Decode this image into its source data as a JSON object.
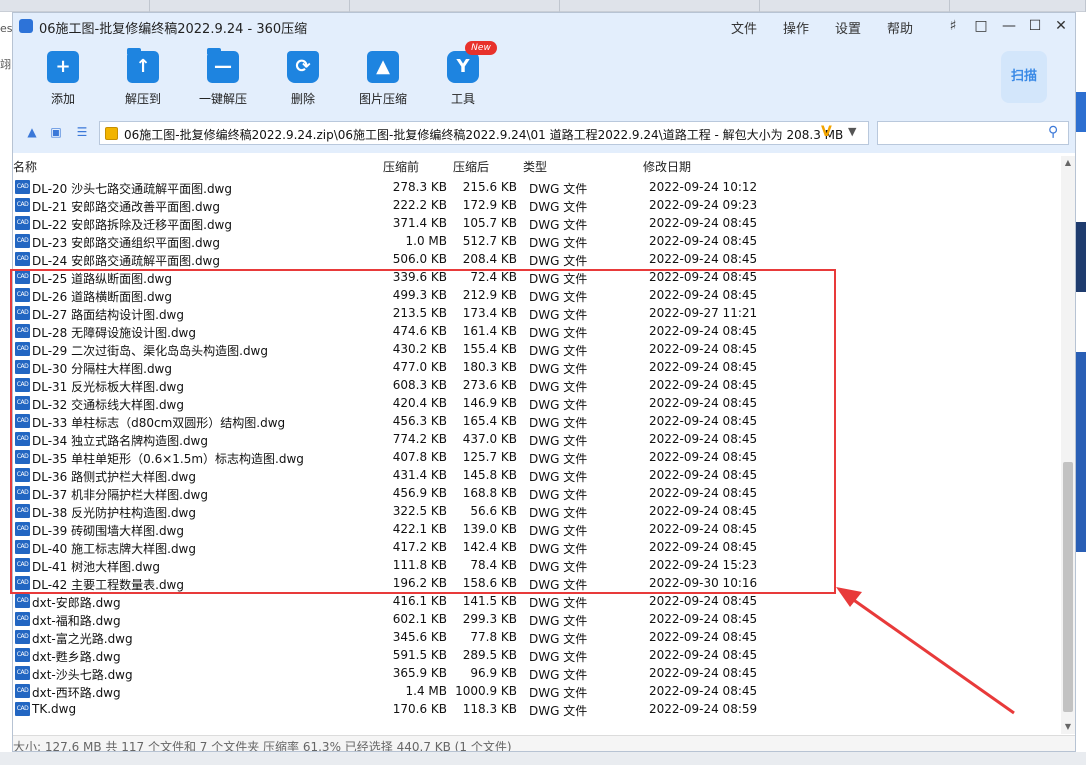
{
  "window": {
    "title": "06施工图-批复修编终稿2022.9.24 - 360压缩",
    "menus": [
      "文件",
      "操作",
      "设置",
      "帮助"
    ]
  },
  "toolbar": {
    "buttons": [
      {
        "label": "添加",
        "icon": "add-icon"
      },
      {
        "label": "解压到",
        "icon": "extract-to-icon"
      },
      {
        "label": "一键解压",
        "icon": "one-click-extract-icon"
      },
      {
        "label": "删除",
        "icon": "delete-icon"
      },
      {
        "label": "图片压缩",
        "icon": "image-compress-icon"
      },
      {
        "label": "工具",
        "icon": "tools-icon"
      }
    ],
    "new_badge": "New",
    "scan_label": "扫描"
  },
  "address": {
    "path": "06施工图-批复修编终稿2022.9.24.zip\\06施工图-批复修编终稿2022.9.24\\01 道路工程2022.9.24\\道路工程 - 解包大小为 208.3 MB"
  },
  "columns": {
    "name": "名称",
    "compressed": "压缩前",
    "after": "压缩后",
    "type": "类型",
    "date": "修改日期"
  },
  "cad_label": "CAD",
  "files": [
    {
      "name": "DL-20 沙头七路交通疏解平面图.dwg",
      "before": "278.3 KB",
      "after": "215.6 KB",
      "type": "DWG 文件",
      "date": "2022-09-24 10:12"
    },
    {
      "name": "DL-21 安郎路交通改善平面图.dwg",
      "before": "222.2 KB",
      "after": "172.9 KB",
      "type": "DWG 文件",
      "date": "2022-09-24 09:23"
    },
    {
      "name": "DL-22 安郎路拆除及迁移平面图.dwg",
      "before": "371.4 KB",
      "after": "105.7 KB",
      "type": "DWG 文件",
      "date": "2022-09-24 08:45"
    },
    {
      "name": "DL-23 安郎路交通组织平面图.dwg",
      "before": "1.0 MB",
      "after": "512.7 KB",
      "type": "DWG 文件",
      "date": "2022-09-24 08:45"
    },
    {
      "name": "DL-24 安郎路交通疏解平面图.dwg",
      "before": "506.0 KB",
      "after": "208.4 KB",
      "type": "DWG 文件",
      "date": "2022-09-24 08:45"
    },
    {
      "name": "DL-25 道路纵断面图.dwg",
      "before": "339.6 KB",
      "after": "72.4 KB",
      "type": "DWG 文件",
      "date": "2022-09-24 08:45"
    },
    {
      "name": "DL-26 道路横断面图.dwg",
      "before": "499.3 KB",
      "after": "212.9 KB",
      "type": "DWG 文件",
      "date": "2022-09-24 08:45"
    },
    {
      "name": "DL-27 路面结构设计图.dwg",
      "before": "213.5 KB",
      "after": "173.4 KB",
      "type": "DWG 文件",
      "date": "2022-09-27 11:21"
    },
    {
      "name": "DL-28 无障碍设施设计图.dwg",
      "before": "474.6 KB",
      "after": "161.4 KB",
      "type": "DWG 文件",
      "date": "2022-09-24 08:45"
    },
    {
      "name": "DL-29 二次过街岛、渠化岛岛头构造图.dwg",
      "before": "430.2 KB",
      "after": "155.4 KB",
      "type": "DWG 文件",
      "date": "2022-09-24 08:45"
    },
    {
      "name": "DL-30 分隔柱大样图.dwg",
      "before": "477.0 KB",
      "after": "180.3 KB",
      "type": "DWG 文件",
      "date": "2022-09-24 08:45"
    },
    {
      "name": "DL-31 反光标板大样图.dwg",
      "before": "608.3 KB",
      "after": "273.6 KB",
      "type": "DWG 文件",
      "date": "2022-09-24 08:45"
    },
    {
      "name": "DL-32 交通标线大样图.dwg",
      "before": "420.4 KB",
      "after": "146.9 KB",
      "type": "DWG 文件",
      "date": "2022-09-24 08:45"
    },
    {
      "name": "DL-33 单柱标志（d80cm双圆形）结构图.dwg",
      "before": "456.3 KB",
      "after": "165.4 KB",
      "type": "DWG 文件",
      "date": "2022-09-24 08:45"
    },
    {
      "name": "DL-34 独立式路名牌构造图.dwg",
      "before": "774.2 KB",
      "after": "437.0 KB",
      "type": "DWG 文件",
      "date": "2022-09-24 08:45"
    },
    {
      "name": "DL-35 单柱单矩形（0.6×1.5m）标志构造图.dwg",
      "before": "407.8 KB",
      "after": "125.7 KB",
      "type": "DWG 文件",
      "date": "2022-09-24 08:45"
    },
    {
      "name": "DL-36 路侧式护栏大样图.dwg",
      "before": "431.4 KB",
      "after": "145.8 KB",
      "type": "DWG 文件",
      "date": "2022-09-24 08:45"
    },
    {
      "name": "DL-37 机非分隔护栏大样图.dwg",
      "before": "456.9 KB",
      "after": "168.8 KB",
      "type": "DWG 文件",
      "date": "2022-09-24 08:45"
    },
    {
      "name": "DL-38 反光防护柱构造图.dwg",
      "before": "322.5 KB",
      "after": "56.6 KB",
      "type": "DWG 文件",
      "date": "2022-09-24 08:45"
    },
    {
      "name": "DL-39 砖砌围墙大样图.dwg",
      "before": "422.1 KB",
      "after": "139.0 KB",
      "type": "DWG 文件",
      "date": "2022-09-24 08:45"
    },
    {
      "name": "DL-40 施工标志牌大样图.dwg",
      "before": "417.2 KB",
      "after": "142.4 KB",
      "type": "DWG 文件",
      "date": "2022-09-24 08:45"
    },
    {
      "name": "DL-41 树池大样图.dwg",
      "before": "111.8 KB",
      "after": "78.4 KB",
      "type": "DWG 文件",
      "date": "2022-09-24 15:23"
    },
    {
      "name": "DL-42 主要工程数量表.dwg",
      "before": "196.2 KB",
      "after": "158.6 KB",
      "type": "DWG 文件",
      "date": "2022-09-30 10:16"
    },
    {
      "name": "dxt-安郎路.dwg",
      "before": "416.1 KB",
      "after": "141.5 KB",
      "type": "DWG 文件",
      "date": "2022-09-24 08:45"
    },
    {
      "name": "dxt-福和路.dwg",
      "before": "602.1 KB",
      "after": "299.3 KB",
      "type": "DWG 文件",
      "date": "2022-09-24 08:45"
    },
    {
      "name": "dxt-富之光路.dwg",
      "before": "345.6 KB",
      "after": "77.8 KB",
      "type": "DWG 文件",
      "date": "2022-09-24 08:45"
    },
    {
      "name": "dxt-甦乡路.dwg",
      "before": "591.5 KB",
      "after": "289.5 KB",
      "type": "DWG 文件",
      "date": "2022-09-24 08:45"
    },
    {
      "name": "dxt-沙头七路.dwg",
      "before": "365.9 KB",
      "after": "96.9 KB",
      "type": "DWG 文件",
      "date": "2022-09-24 08:45"
    },
    {
      "name": "dxt-西环路.dwg",
      "before": "1.4 MB",
      "after": "1000.9 KB",
      "type": "DWG 文件",
      "date": "2022-09-24 08:45"
    },
    {
      "name": "TK.dwg",
      "before": "170.6 KB",
      "after": "118.3 KB",
      "type": "DWG 文件",
      "date": "2022-09-24 08:59"
    }
  ],
  "status": "大小: 127.6 MB 共 117 个文件和 7 个文件夹 压缩率 61.3% 已经选择 440.7 KB (1 个文件)",
  "background": {
    "left_fragments": [
      "es",
      "翊"
    ]
  },
  "colors": {
    "accent": "#1e84e0",
    "annotation": "#e83a3a",
    "title_bg": "#e3eefc"
  }
}
